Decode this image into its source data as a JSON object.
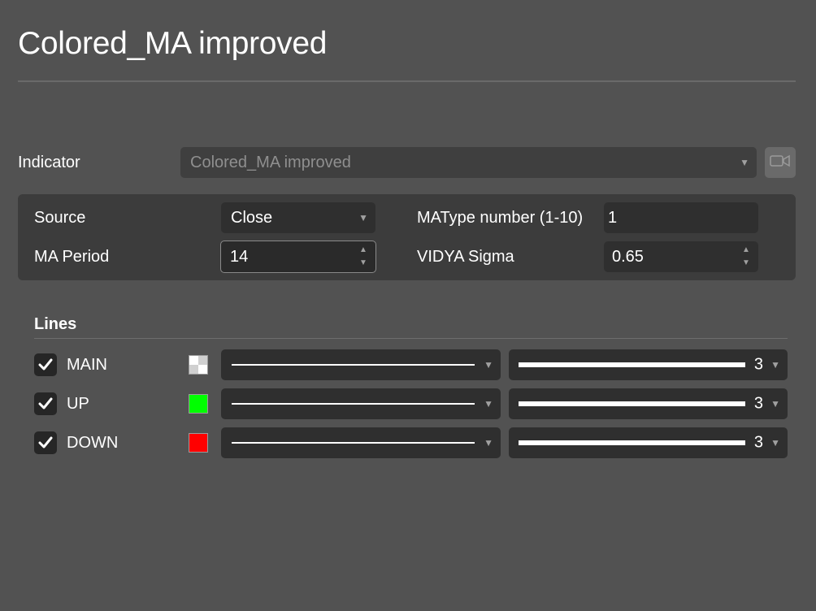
{
  "dialog": {
    "title": "Colored_MA improved"
  },
  "indicator": {
    "label": "Indicator",
    "value": "Colored_MA improved"
  },
  "params": {
    "source_label": "Source",
    "source_value": "Close",
    "ma_period_label": "MA Period",
    "ma_period_value": "14",
    "matype_label": "MAType number (1-10)",
    "matype_value": "1",
    "vidya_label": "VIDYA Sigma",
    "vidya_value": "0.65"
  },
  "lines": {
    "section_title": "Lines",
    "items": [
      {
        "label": "MAIN",
        "checked": true,
        "color": "checker",
        "width": "3"
      },
      {
        "label": "UP",
        "checked": true,
        "color": "#00ff00",
        "width": "3"
      },
      {
        "label": "DOWN",
        "checked": true,
        "color": "#ff0000",
        "width": "3"
      }
    ]
  },
  "colors": {
    "background": "#525252",
    "panel": "#3c3c3c",
    "field": "#2f2f2f",
    "up": "#00ff00",
    "down": "#ff0000"
  }
}
